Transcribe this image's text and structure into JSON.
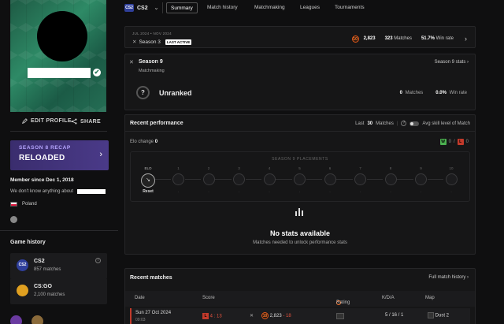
{
  "profile": {
    "verified_glyph": "✔",
    "edit_label": "EDIT PROFILE",
    "share_label": "SHARE"
  },
  "recap": {
    "small": "SEASON 8 RECAP",
    "big": "RELOADED"
  },
  "about": {
    "member_since": "Member since Dec 1, 2018",
    "about_text": "We don't know anything about",
    "country": "Poland"
  },
  "game_history": {
    "title": "Game history",
    "games": [
      {
        "name": "CS2",
        "matches": "857 matches",
        "icon_color": "#2f3f9a"
      },
      {
        "name": "CS:GO",
        "matches": "2,100 matches",
        "icon_color": "#e0a020"
      }
    ]
  },
  "nav": {
    "game": "CS2",
    "game_logo": "CS2",
    "tabs": [
      "Summary",
      "Match history",
      "Matchmaking",
      "Leagues",
      "Tournaments"
    ]
  },
  "season_bar": {
    "dates": "JUL 2024 • NOV 2024",
    "season": "Season 3",
    "badge": "LAST ACTIVE",
    "elo": "2,823",
    "matches": "323",
    "matches_label": "Matches",
    "winrate": "51.7%",
    "winrate_label": "Win rate",
    "level": "10"
  },
  "season9": {
    "title": "Season 9",
    "subtitle": "Matchmaking",
    "stats_link": "Season 9 stats",
    "rank": "Unranked",
    "rank_icon": "?",
    "matches": "0",
    "matches_label": "Matches",
    "winrate": "0.0%",
    "winrate_label": "Win rate"
  },
  "performance": {
    "title": "Recent performance",
    "last_prefix": "Last",
    "last_count": "30",
    "last_suffix": "Matches",
    "avg_label": "Avg skill level of Match",
    "elo_change_label": "Elo change",
    "elo_change_value": "0",
    "wins": "W",
    "win_count": "0",
    "losses": "L",
    "loss_count": "0",
    "placements_title": "SEASON 9 PLACEMENTS",
    "placement_start_label": "ELO",
    "placement_start_value": "Reset",
    "placement_numbers": [
      "1",
      "2",
      "3",
      "4",
      "5",
      "6",
      "7",
      "8",
      "9",
      "10"
    ],
    "no_stats": "No stats available",
    "no_stats_sub": "Matches needed to unlock performance stats"
  },
  "recent_matches": {
    "title": "Recent matches",
    "link": "Full match history",
    "columns": [
      "Date",
      "Score",
      "Rating",
      "K/D/A",
      "Map"
    ],
    "rows": [
      {
        "date": "Sun 27 Oct 2024",
        "time": "09:03",
        "result": "L",
        "score": "4 : 13",
        "level": "10",
        "elo": "2,823",
        "elo_change": "- 18",
        "kda": "5 / 16 / 1",
        "map": "Dust 2"
      }
    ]
  },
  "colors": {
    "accent_orange": "#ff7a30",
    "loss_red": "#c23a2b",
    "win_green": "#4caf50",
    "recap_purple": "#4a3a88"
  }
}
